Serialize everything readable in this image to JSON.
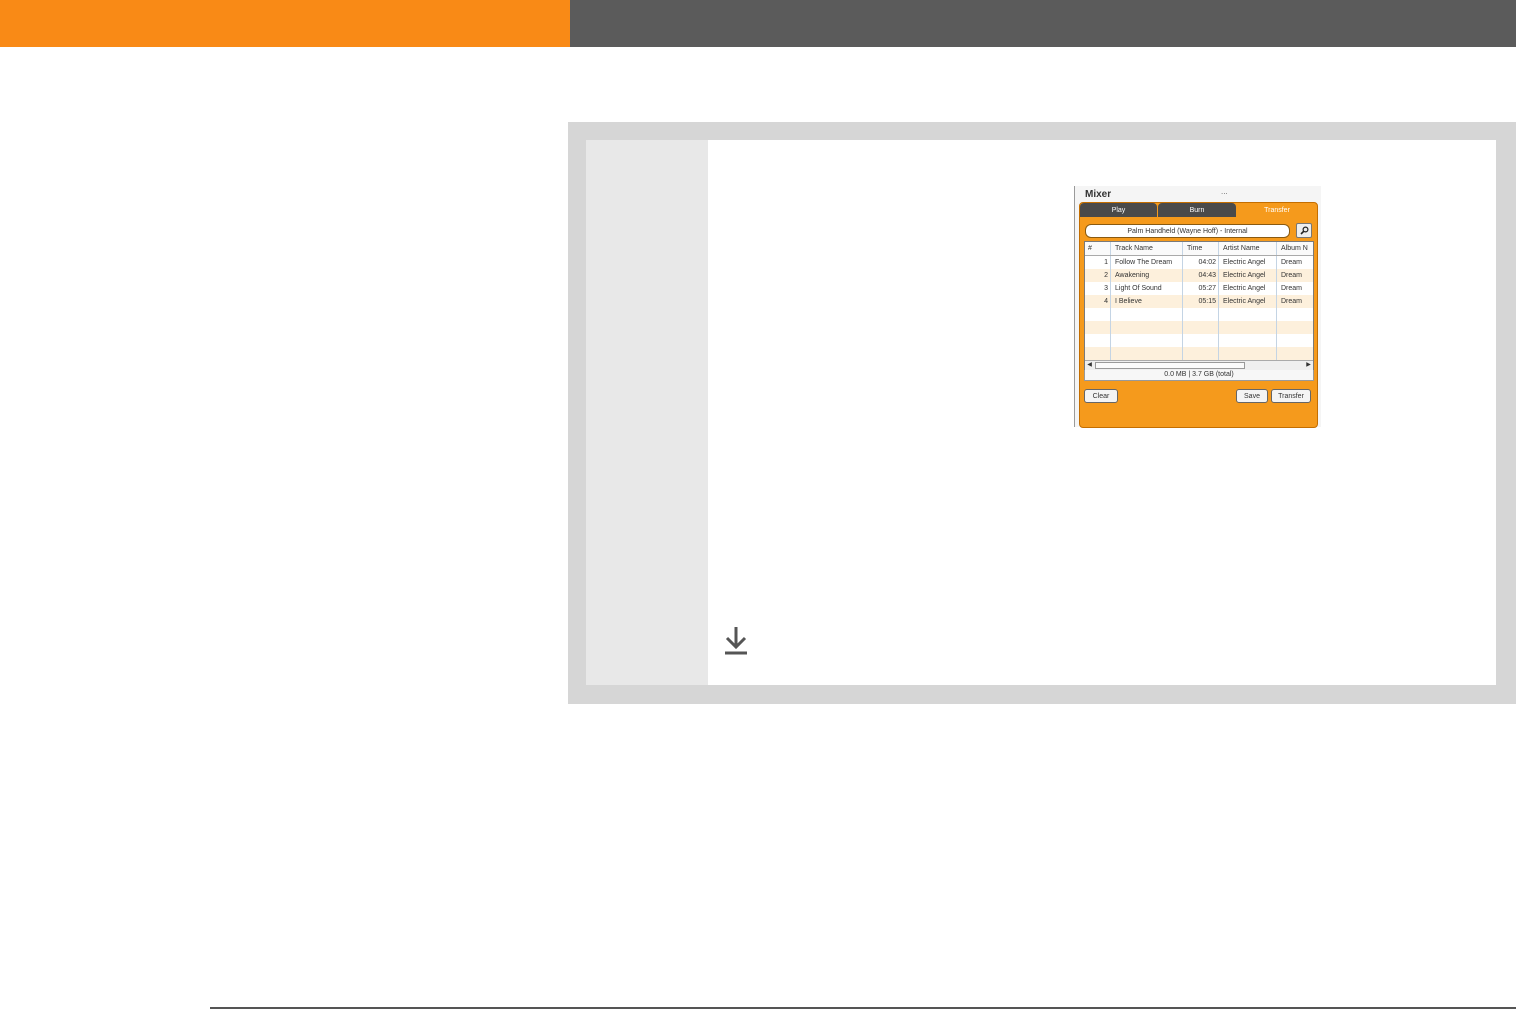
{
  "mixer": {
    "title": "Mixer",
    "title_dots": "...",
    "tabs": [
      {
        "label": "Play",
        "active": false
      },
      {
        "label": "Burn",
        "active": false
      },
      {
        "label": "Transfer",
        "active": true
      }
    ],
    "device": "Palm Handheld (Wayne Hoff) - Internal",
    "search_icon": "magnifier-icon",
    "columns": [
      "#",
      "Track Name",
      "Time",
      "Artist Name",
      "Album N"
    ],
    "tracks": [
      {
        "num": "1",
        "name": "Follow The Dream",
        "time": "04:02",
        "artist": "Electric Angel",
        "album": "Dream"
      },
      {
        "num": "2",
        "name": "Awakening",
        "time": "04:43",
        "artist": "Electric Angel",
        "album": "Dream"
      },
      {
        "num": "3",
        "name": "Light Of Sound",
        "time": "05:27",
        "artist": "Electric Angel",
        "album": "Dream"
      },
      {
        "num": "4",
        "name": "I Believe",
        "time": "05:15",
        "artist": "Electric Angel",
        "album": "Dream"
      }
    ],
    "status": "0.0 MB | 3.7 GB (total)",
    "buttons": {
      "clear": "Clear",
      "save": "Save",
      "transfer": "Transfer"
    }
  },
  "colors": {
    "header_orange": "#f98a16",
    "header_gray": "#5b5b5b",
    "mixer_orange": "#f59a1c"
  },
  "icons": {
    "download": "download-arrow-icon"
  }
}
